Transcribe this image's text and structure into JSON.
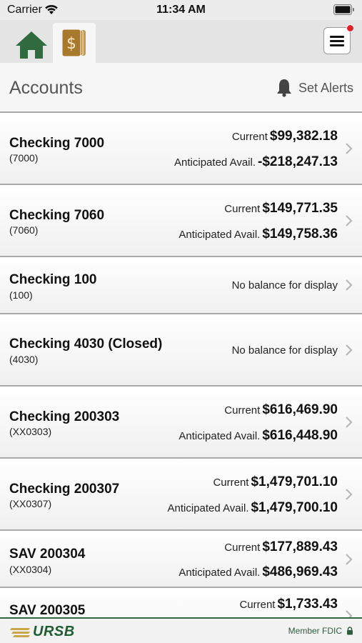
{
  "status_bar": {
    "carrier": "Carrier",
    "time": "11:34 AM"
  },
  "nav": {
    "notification_badge": true
  },
  "header": {
    "title": "Accounts",
    "alerts_label": "Set Alerts"
  },
  "accounts": [
    {
      "name": "Checking 7000",
      "number": "(7000)",
      "current_label": "Current",
      "current": "$99,382.18",
      "anticipated_label": "Anticipated Avail.",
      "anticipated": "-$218,247.13"
    },
    {
      "name": "Checking 7060",
      "number": "(7060)",
      "current_label": "Current",
      "current": "$149,771.35",
      "anticipated_label": "Anticipated Avail.",
      "anticipated": "$149,758.36"
    },
    {
      "name": "Checking 100",
      "number": "(100)",
      "no_balance": "No balance for display"
    },
    {
      "name": "Checking 4030 (Closed)",
      "number": "(4030)",
      "no_balance": "No balance for display"
    },
    {
      "name": "Checking 200303",
      "number": "(XX0303)",
      "current_label": "Current",
      "current": "$616,469.90",
      "anticipated_label": "Anticipated Avail.",
      "anticipated": "$616,448.90"
    },
    {
      "name": "Checking 200307",
      "number": "(XX0307)",
      "current_label": "Current",
      "current": "$1,479,701.10",
      "anticipated_label": "Anticipated Avail.",
      "anticipated": "$1,479,700.10"
    },
    {
      "name": "SAV 200304",
      "number": "(XX0304)",
      "current_label": "Current",
      "current": "$177,889.43",
      "anticipated_label": "Anticipated Avail.",
      "anticipated": "$486,969.43"
    },
    {
      "name": "SAV 200305",
      "current_label": "Current",
      "current": "$1,733.43"
    }
  ],
  "footer": {
    "logo": "URSB",
    "fdic_label": "Member FDIC"
  },
  "colors": {
    "brand_green": "#2f6b3e",
    "gold": "#b8893a",
    "badge_red": "#e0202a"
  }
}
